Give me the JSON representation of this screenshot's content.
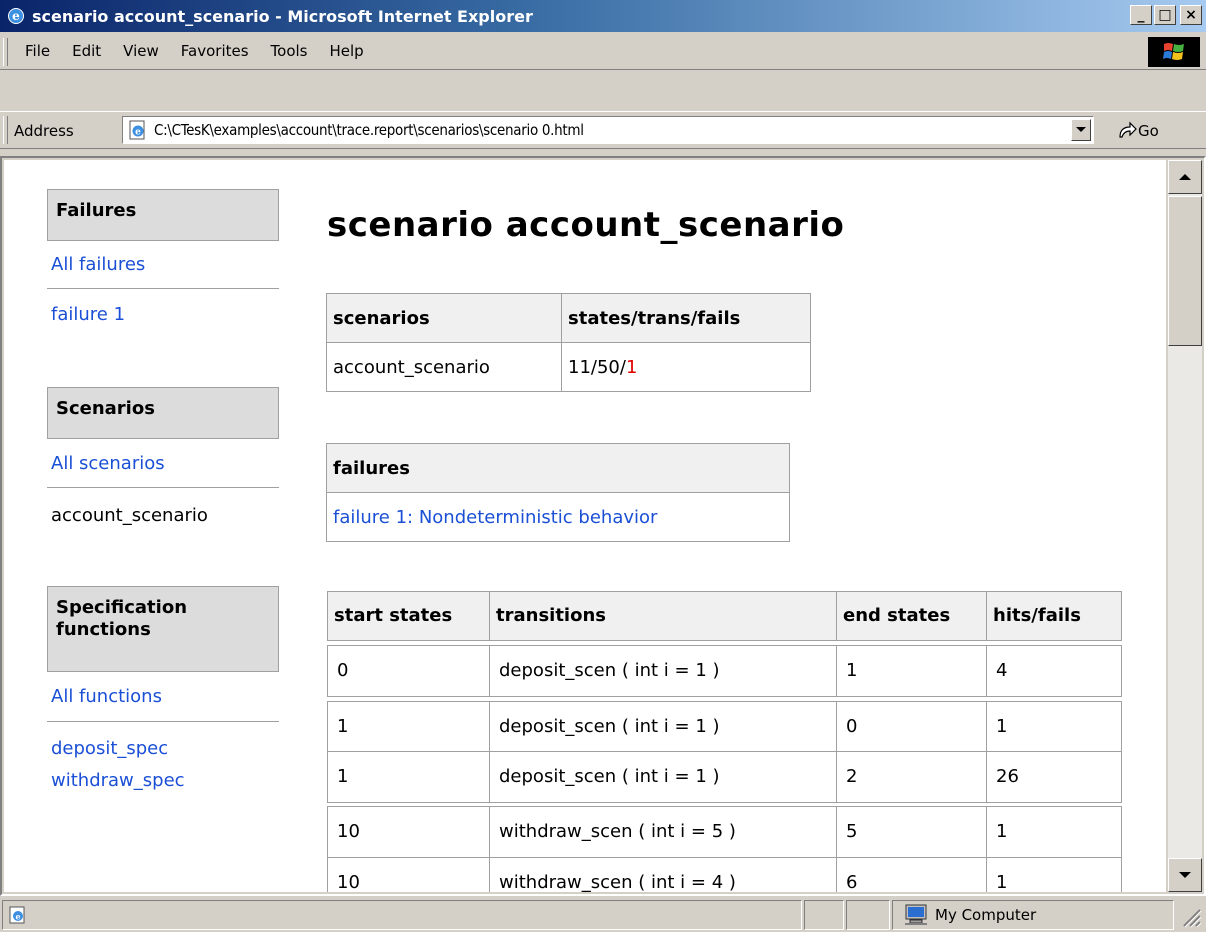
{
  "window": {
    "title": "scenario account_scenario - Microsoft Internet Explorer",
    "minimize": "_",
    "maximize": "□",
    "close": "×"
  },
  "menu": {
    "items": [
      "File",
      "Edit",
      "View",
      "Favorites",
      "Tools",
      "Help"
    ]
  },
  "address": {
    "label": "Address",
    "value": "C:\\CTesK\\examples\\account\\trace.report\\scenarios\\scenario 0.html",
    "go_label": "Go"
  },
  "sidebar": {
    "failures_heading": "Failures",
    "all_failures": "All failures",
    "failure_1": "failure 1",
    "scenarios_heading": "Scenarios",
    "all_scenarios": "All scenarios",
    "current_scenario": "account_scenario",
    "functions_heading_line1": "Specification",
    "functions_heading_line2": "functions",
    "all_functions": "All functions",
    "function_1": "deposit_spec",
    "function_2": "withdraw_spec"
  },
  "main": {
    "title": "scenario account_scenario",
    "scenarios_table": {
      "headers": [
        "scenarios",
        "states/trans/fails"
      ],
      "row": {
        "name": "account_scenario",
        "states_trans": "11/50/",
        "fails": "1"
      }
    },
    "failures_table": {
      "header": "failures",
      "row": "failure 1: Nondeterministic behavior"
    },
    "transitions_table": {
      "headers": [
        "start states",
        "transitions",
        "end states",
        "hits/fails"
      ],
      "rows": [
        [
          "0",
          "deposit_scen ( int i = 1 )",
          "1",
          "4"
        ],
        [
          "1",
          "deposit_scen ( int i = 1 )",
          "0",
          "1"
        ],
        [
          "1",
          "deposit_scen ( int i = 1 )",
          "2",
          "26"
        ],
        [
          "10",
          "withdraw_scen ( int i = 5 )",
          "5",
          "1"
        ],
        [
          "10",
          "withdraw_scen ( int i = 4 )",
          "6",
          "1"
        ]
      ]
    }
  },
  "status": {
    "zone": "My Computer"
  },
  "colors": {
    "link": "#1a4fd6",
    "fail": "#e00000",
    "titlebar_start": "#0a246a",
    "titlebar_end": "#a6caf0"
  }
}
